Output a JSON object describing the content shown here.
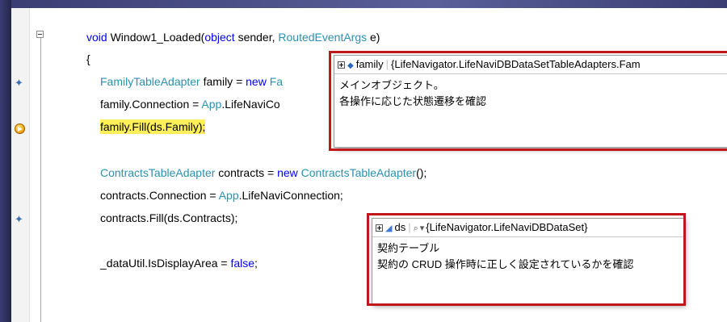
{
  "code": {
    "line1": {
      "kw_void": "void",
      "text1": " Window1_Loaded(",
      "kw_object": "object",
      "text2": " sender, ",
      "type": "RoutedEventArgs",
      "text3": " e)"
    },
    "line2": "{",
    "line3": {
      "type": "FamilyTableAdapter",
      "text1": " family = ",
      "kw_new": "new",
      "text2": " ",
      "type_partial": "Fa"
    },
    "line4": {
      "text1": "family.Connection = ",
      "app": "App",
      "text2": ".LifeNaviCo"
    },
    "line5": "family.Fill(ds.Family);",
    "line6": {
      "type": "ContractsTableAdapter",
      "text1": " contracts = ",
      "kw_new": "new",
      "text2": " ",
      "type2": "ContractsTableAdapter",
      "text3": "();"
    },
    "line7": {
      "text1": "contracts.Connection = ",
      "app": "App",
      "text2": ".LifeNaviConnection;"
    },
    "line8": "contracts.Fill(ds.Contracts);",
    "line9": {
      "text1": "_dataUtil.IsDisplayArea = ",
      "kw_false": "false",
      "text2": ";"
    }
  },
  "tooltip_family": {
    "name": "family",
    "value": "{LifeNavigator.LifeNaviDBDataSetTableAdapters.Fam",
    "comment_line1": "メインオブジェクト。",
    "comment_line2": "各操作に応じた状態遷移を確認"
  },
  "tooltip_ds": {
    "name": "ds",
    "magnifier": "⌕",
    "dropdown": "▾",
    "value": "{LifeNavigator.LifeNaviDBDataSet}",
    "comment_line1": "契約テーブル",
    "comment_line2": "契約の CRUD 操作時に正しく設定されているかを確認"
  },
  "colors": {
    "keyword": "#0000ff",
    "type": "#2b91af",
    "highlight": "#ffef5a",
    "callout": "#c0181a"
  }
}
